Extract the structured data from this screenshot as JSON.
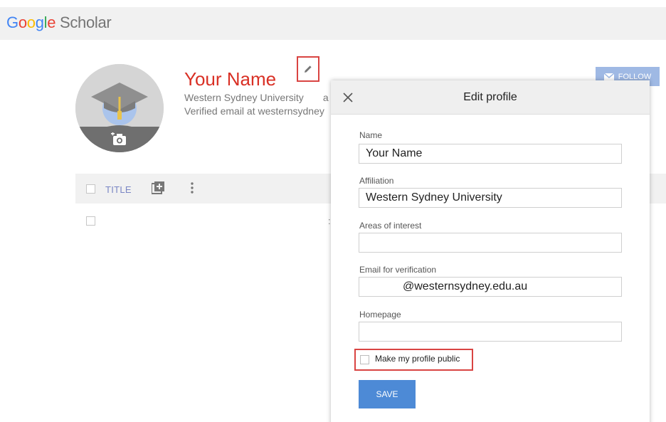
{
  "logo": {
    "text_google": [
      "G",
      "o",
      "o",
      "g",
      "l",
      "e"
    ],
    "text_scholar": " Scholar"
  },
  "profile": {
    "name": "Your Name",
    "affiliation": "Western Sydney University",
    "affiliation_tail": "a",
    "email": "Verified email at westernsydney"
  },
  "follow_button": {
    "label": "FOLLOW"
  },
  "table": {
    "title_header": "TITLE",
    "row_stub": ":"
  },
  "dialog": {
    "title": "Edit profile",
    "fields": {
      "name": {
        "label": "Name",
        "value": "Your Name"
      },
      "affiliation": {
        "label": "Affiliation",
        "value": "Western Sydney University"
      },
      "interests": {
        "label": "Areas of interest",
        "value": ""
      },
      "email": {
        "label": "Email for verification",
        "value": "@westernsydney.edu.au"
      },
      "homepage": {
        "label": "Homepage",
        "value": ""
      }
    },
    "public_checkbox": {
      "label": "Make my profile public",
      "checked": false
    },
    "save_label": "SAVE"
  },
  "colors": {
    "name_red": "#d93025",
    "highlight_red": "#d94442",
    "save_blue": "#4d8ad6",
    "follow_blue": "#9fb9e4",
    "title_header": "#7a86c4"
  },
  "icons": [
    "camera-add-icon",
    "pencil-icon",
    "mail-icon",
    "close-icon",
    "add-box-icon",
    "more-vert-icon",
    "graduation-cap-icon"
  ]
}
